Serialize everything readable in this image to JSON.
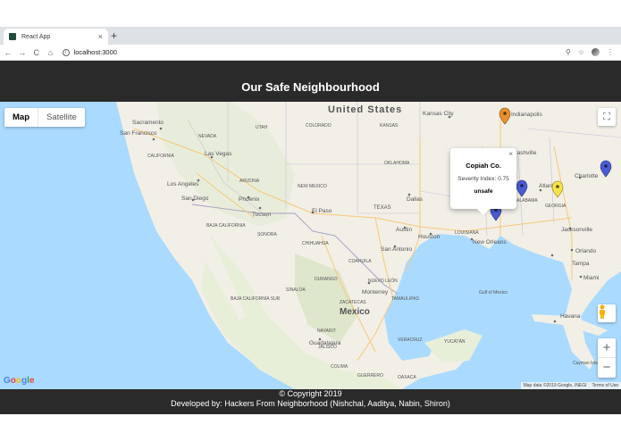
{
  "browser": {
    "tab_title": "React App",
    "tab_close": "×",
    "new_tab": "+",
    "url": "localhost:3000",
    "back": "←",
    "forward": "→",
    "reload": "C",
    "home": "⌂",
    "zoom_icon": "⚲",
    "star_icon": "☆",
    "menu_icon": "⋮",
    "info": "i"
  },
  "header": {
    "title": "Our Safe Neighbourhood"
  },
  "map": {
    "type_map": "Map",
    "type_satellite": "Satellite",
    "fullscreen_icon": "⛶",
    "zoom_in": "+",
    "zoom_out": "−",
    "labels": {
      "united_states": "United States",
      "mexico": "Mexico",
      "new_mexico": "NEW MEXICO",
      "kansas_city": "Kansas City",
      "indianapolis": "Indianapolis",
      "sacramento": "Sacramento",
      "san_francisco": "San Francisco",
      "las_vegas": "Las Vegas",
      "los_angeles": "Los Angeles",
      "san_diego": "San Diego",
      "phoenix": "Phoenix",
      "tucson": "Tucson",
      "el_paso": "El Paso",
      "dallas": "Dallas",
      "austin": "Austin",
      "houston": "Houston",
      "san_antonio": "San Antonio",
      "new_orleans": "New Orleans",
      "nashville": "Nashville",
      "atlanta": "Atlanta",
      "charlotte": "Charlotte",
      "jacksonville": "Jacksonville",
      "tampa": "Tampa",
      "orlando": "Orlando",
      "miami": "Miami",
      "havana": "Havana",
      "cayman_islands": "Cayman Islands",
      "monterrey": "Monterrey",
      "guadalajara": "Guadalajara",
      "gulf_of_mexico": "Gulf of Mexico",
      "nevada": "NEVADA",
      "utah": "UTAH",
      "colorado": "COLORADO",
      "kansas": "KANSAS",
      "oklahoma": "OKLAHOMA",
      "texas": "TEXAS",
      "arizona": "ARIZONA",
      "california": "CALIFORNIA",
      "louisiana": "LOUISIANA",
      "alabama": "ALABAMA",
      "georgia": "GEORGIA",
      "sonora": "SONORA",
      "chihuahua": "CHIHUAHUA",
      "coahuila": "COAHUILA",
      "durango": "DURANGO",
      "sinaloa": "SINALOA",
      "nuevo_leon": "NUEVO LEÓN",
      "baja_california": "BAJA CALIFORNIA",
      "baja_california_sur": "BAJA CALIFORNIA SUR",
      "tamaulipas": "TAMAULIPAS",
      "zacatecas": "ZACATECAS",
      "jalisco": "JALISCO",
      "guerrero": "GUERRERO",
      "oaxaca": "OAXACA",
      "yucatan": "YUCATÁN",
      "nayarit": "NAYARIT",
      "colima": "COLIMA",
      "veracruz": "VERACRUZ"
    },
    "markers": [
      {
        "name": "marker-indianapolis",
        "color": "#e8912c"
      },
      {
        "name": "marker-charlotte",
        "color": "#4a5bd4"
      },
      {
        "name": "marker-alabama",
        "color": "#4a5bd4"
      },
      {
        "name": "marker-georgia",
        "color": "#f4e44c"
      },
      {
        "name": "marker-copiah",
        "color": "#4a5bd4"
      }
    ],
    "popup": {
      "county": "Copiah Co.",
      "severity": "Severity Index: 0.75",
      "status": "unsafe",
      "close": "×"
    },
    "attribution": {
      "data": "Map data ©2019 Google, INEGI",
      "terms": "Terms of Use"
    },
    "logo": [
      "G",
      "o",
      "o",
      "g",
      "l",
      "e"
    ]
  },
  "footer": {
    "copyright": "© Copyright 2019",
    "developers": "Developed by: Hackers From Neighborhood (Nishchal, Aaditya, Nabin, Shiron)"
  }
}
